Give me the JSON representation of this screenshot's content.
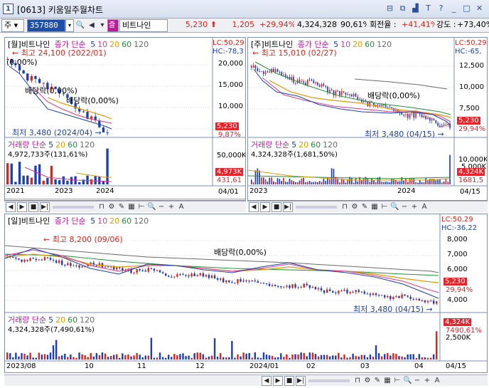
{
  "window": {
    "title": "[0613] 키움일주월차트"
  },
  "toolbar": {
    "market": "주",
    "code": "357880",
    "name": "비트나인",
    "sign": "즐",
    "price": "5,230",
    "change": "1,205",
    "change_pct": "+29,94%",
    "volume": "4,324,328",
    "volume_pct": "90,61%",
    "turnover_label": "회전율 :",
    "turnover": "+41,41%",
    "strength_label": "강도 :",
    "strength": "+73,40%"
  },
  "monthly": {
    "title": "[월]비트나인",
    "ma_label": "종가 단순",
    "ma": [
      "5",
      "10",
      "20",
      "60",
      "120"
    ],
    "high": "최고 24,100 (2022/01)",
    "low": "최저 3,480 (2024/04)",
    "pct": "(0,00%)",
    "div": "배당락(0,00%)",
    "div2": "배당락(0,00%)",
    "lc": "LC:50,29",
    "hc": "HC:-78,3",
    "yticks": [
      "20,000",
      "15,000",
      "10,000"
    ],
    "price_tag": "5,230",
    "pct_tag": "9,87%",
    "vol_title": "거래량 단순",
    "vol_value": "4,972,733주(131,61%)",
    "vol_ticks": [
      "50,000K",
      "10,000K"
    ],
    "vol_tag": "4,973K",
    "vol_tag2": "431,61",
    "xticks": [
      "2021",
      "2023",
      "2024"
    ],
    "date": "04/01"
  },
  "weekly": {
    "title": "[주]비트나인",
    "ma_label": "종가 단순",
    "ma": [
      "5",
      "10",
      "20",
      "60",
      "120"
    ],
    "high": "최고 15,010 (02/27)",
    "low": "최저 3,480 (04/15)",
    "div": "배당락(0,00%)",
    "lc": "LC:50,29",
    "hc": "HC:-65,",
    "yticks": [
      "12,500",
      "10,000",
      "7,500"
    ],
    "price_tag": "5,230",
    "pct_tag": "29,94%",
    "vol_title": "거래량 단순",
    "vol_value": "4,324,328주(1,681,50%)",
    "vol_ticks": [
      "10,000K",
      "5,000K"
    ],
    "vol_tag": "4,324K",
    "vol_tag2": "1681,5",
    "xticks": [
      "2023",
      "2024"
    ],
    "date": "04/15"
  },
  "daily": {
    "title": "[일]비트나인",
    "ma_label": "종가 단순",
    "ma": [
      "5",
      "10",
      "20",
      "60",
      "120"
    ],
    "high": "최고 8,200 (09/06)",
    "low": "최저 3,480 (04/15)",
    "div": "배당락(0,00%)",
    "lc": "LC:50,29",
    "hc": "HC:-36,22",
    "yticks": [
      "8,000",
      "7,000",
      "6,000",
      "4,000"
    ],
    "price_tag": "5,230",
    "pct_tag": "29,94%",
    "vol_title": "거래량 단순",
    "vol_value": "4,324,328주(7,490,61%)",
    "vol_ticks": [
      "2,500K"
    ],
    "vol_tag": "4,324K",
    "vol_tag2": "7490,61%",
    "xticks": [
      "2023/08",
      "10",
      "11",
      "12",
      "2024/01",
      "02",
      "03",
      "04"
    ],
    "date": "04/15"
  },
  "colors": {
    "up": "#e2231a",
    "down": "#1f3fb4",
    "ma5": "#1f3fb4",
    "ma10": "#d63a8e",
    "ma20": "#e59a00",
    "ma60": "#22913a",
    "ma120": "#6b6b6b"
  }
}
